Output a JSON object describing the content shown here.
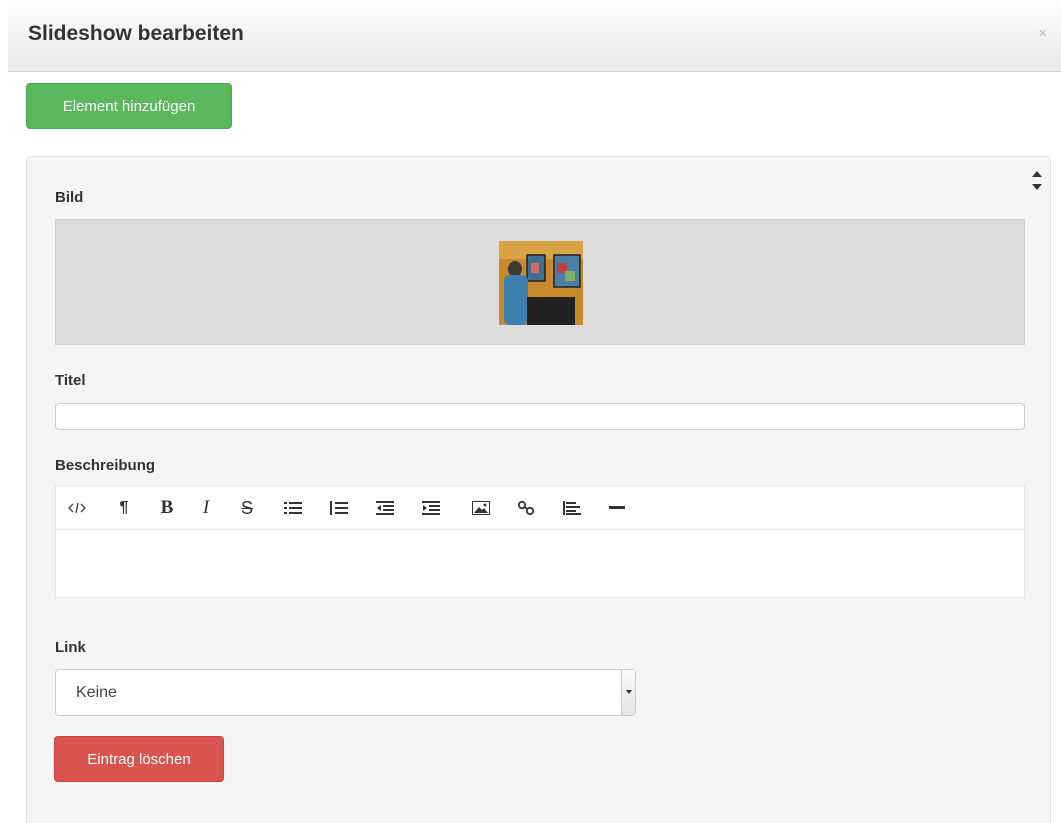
{
  "modal": {
    "title": "Slideshow bearbeiten",
    "close_label": "×"
  },
  "toolbar": {
    "add_label": "Element hinzufügen"
  },
  "item": {
    "image_label": "Bild",
    "title_label": "Titel",
    "title_value": "",
    "description_label": "Beschreibung",
    "link_label": "Link",
    "link_selected": "Keine",
    "delete_label": "Eintrag löschen"
  },
  "editor_buttons": [
    "code-icon",
    "paragraph-icon",
    "bold-icon",
    "italic-icon",
    "strikethrough-icon",
    "unordered-list-icon",
    "ordered-list-icon",
    "outdent-icon",
    "indent-icon",
    "image-icon",
    "link-icon",
    "align-icon",
    "horizontal-rule-icon"
  ],
  "colors": {
    "success": "#5cb85c",
    "danger": "#d9534f"
  }
}
